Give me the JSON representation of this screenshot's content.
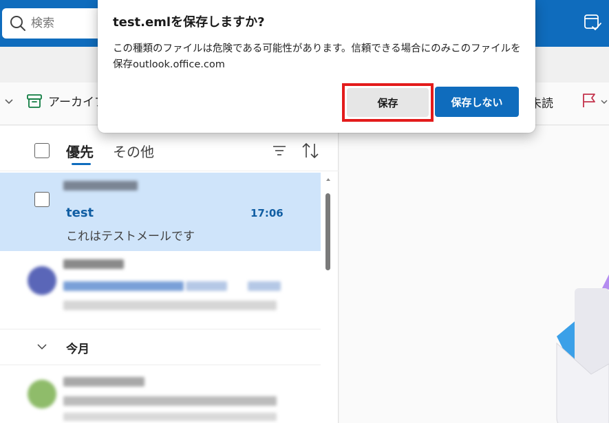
{
  "search": {
    "placeholder": "検索"
  },
  "ribbon": {
    "archive_label": "アーカイブ",
    "unread_label": "未読"
  },
  "list": {
    "tabs": [
      {
        "label": "優先"
      },
      {
        "label": "その他"
      }
    ],
    "selected_mail": {
      "subject": "test",
      "time": "17:06",
      "preview": "これはテストメールです"
    },
    "group_header": "今月"
  },
  "dialog": {
    "title": "test.emlを保存しますか?",
    "message": "この種類のファイルは危険である可能性があります。信頼できる場合にのみこのファイルを保存outlook.office.com",
    "save_label": "保存",
    "dont_save_label": "保存しない"
  },
  "colors": {
    "accent": "#0f6cbd",
    "selected_row": "#cfe4fa",
    "highlight": "#e31b1b"
  },
  "icons": [
    "search-icon",
    "calendar-check-icon",
    "chevron-down-icon",
    "archive-icon",
    "flag-icon",
    "filter-icon",
    "sort-icon"
  ]
}
